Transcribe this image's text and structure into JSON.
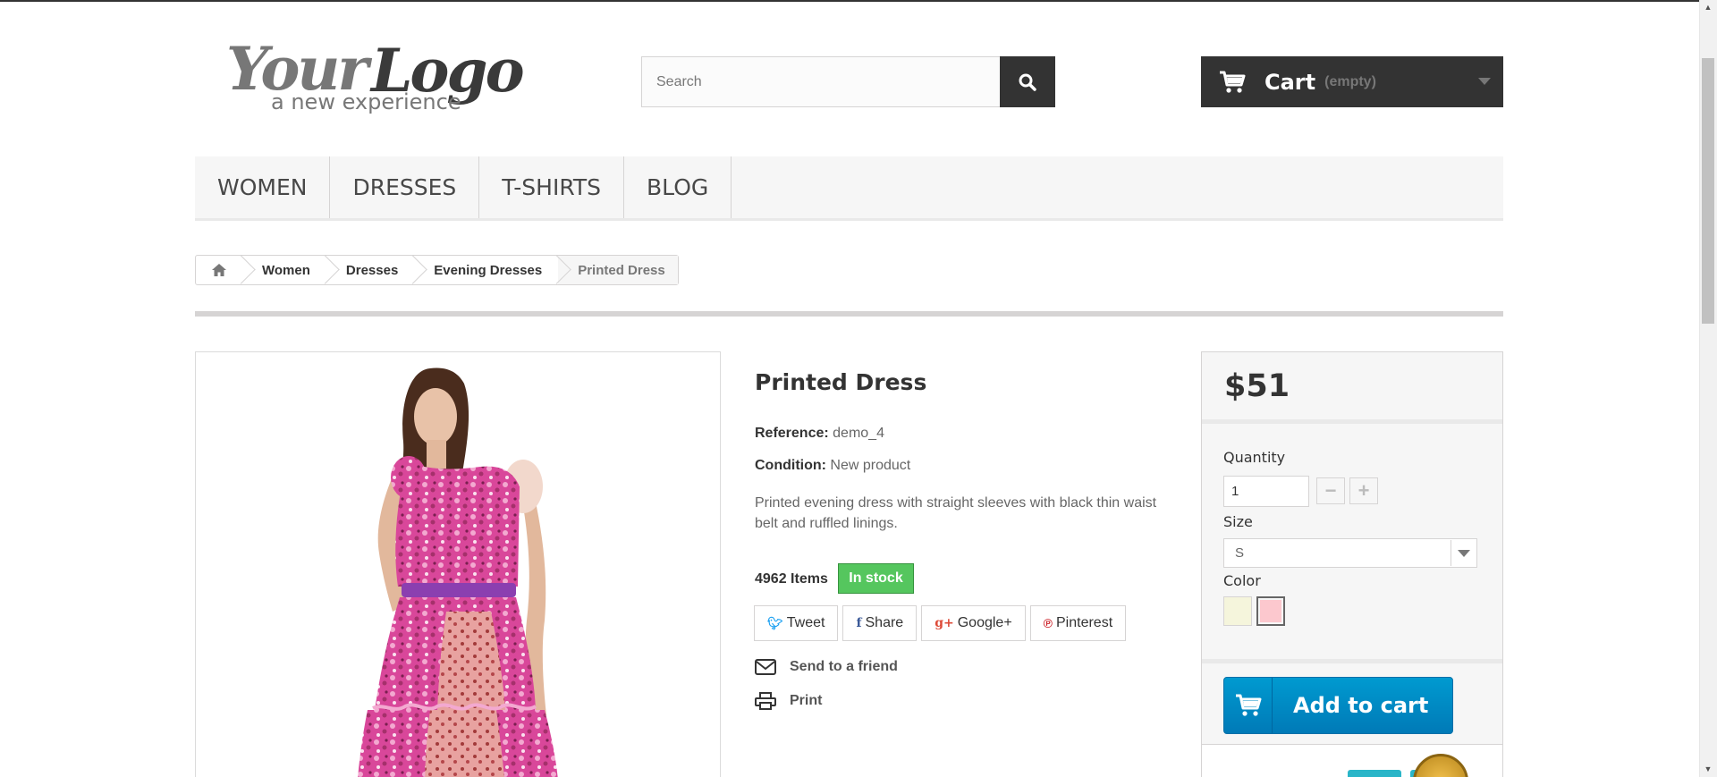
{
  "logo": {
    "main": "YourLogo",
    "tagline": "a new experience"
  },
  "search": {
    "placeholder": "Search",
    "value": ""
  },
  "cart": {
    "label": "Cart",
    "status": "(empty)"
  },
  "nav": {
    "items": [
      "Women",
      "Dresses",
      "T-shirts",
      "Blog"
    ]
  },
  "breadcrumb": {
    "items": [
      "Women",
      "Dresses",
      "Evening Dresses"
    ],
    "current": "Printed Dress"
  },
  "product": {
    "title": "Printed Dress",
    "reference_label": "Reference:",
    "reference": "demo_4",
    "condition_label": "Condition:",
    "condition": "New product",
    "description": "Printed evening dress with straight sleeves with black thin waist belt and ruffled linings.",
    "quantity_available": "4962 Items",
    "stock_status": "In stock"
  },
  "social": {
    "tweet": "Tweet",
    "share": "Share",
    "google": "Google+",
    "pinterest": "Pinterest"
  },
  "actions": {
    "send": "Send to a friend",
    "print": "Print"
  },
  "buy": {
    "price": "$51",
    "quantity_label": "Quantity",
    "quantity_value": "1",
    "size_label": "Size",
    "size_value": "S",
    "color_label": "Color",
    "colors": [
      "#f5f5dc",
      "#fcc8ce"
    ],
    "add_to_cart": "Add to cart"
  },
  "colors": {
    "dark": "#333333",
    "in_stock": "#55c65e",
    "add_to_cart": "#0089c6"
  }
}
